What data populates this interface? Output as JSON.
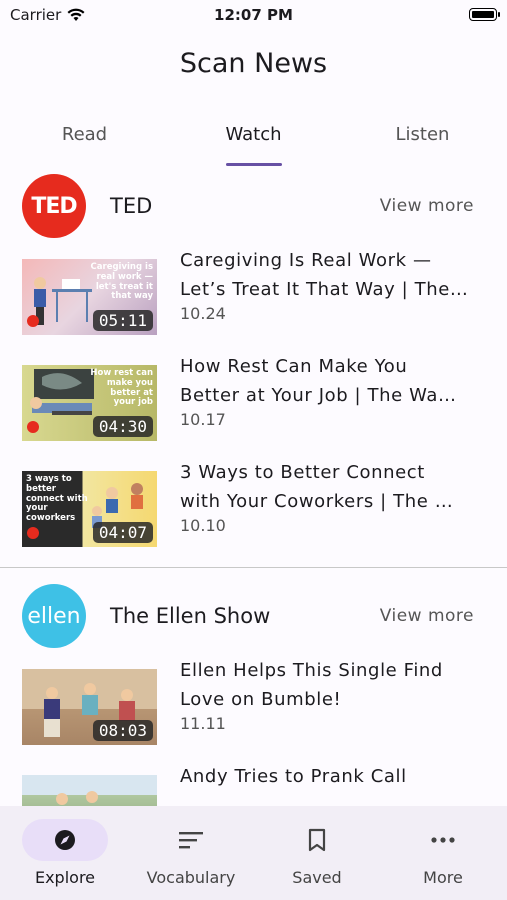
{
  "status_bar": {
    "carrier": "Carrier",
    "time": "12:07 PM"
  },
  "header": {
    "title": "Scan News"
  },
  "tabs": [
    {
      "label": "Read",
      "active": false
    },
    {
      "label": "Watch",
      "active": true
    },
    {
      "label": "Listen",
      "active": false
    }
  ],
  "channels": [
    {
      "name": "TED",
      "logo_text": "TED",
      "view_more": "View more",
      "videos": [
        {
          "title_line1": "Caregiving Is Real Work —",
          "title_line2": "Let’s Treat It That Way | The…",
          "date": "10.24",
          "duration": "05:11",
          "thumb_text": "Caregiving is real work — let's treat it that way"
        },
        {
          "title_line1": "How Rest Can Make You",
          "title_line2": "Better at Your Job | The Wa…",
          "date": "10.17",
          "duration": "04:30",
          "thumb_text": "How rest can make you better at your job"
        },
        {
          "title_line1": "3 Ways to Better Connect",
          "title_line2": "with Your Coworkers | The …",
          "date": "10.10",
          "duration": "04:07",
          "thumb_text": "3 ways to better connect with your coworkers"
        }
      ]
    },
    {
      "name": "The Ellen Show",
      "logo_text": "ellen",
      "view_more": "View more",
      "videos": [
        {
          "title_line1": "Ellen Helps This Single Find",
          "title_line2": "Love on Bumble!",
          "date": "11.11",
          "duration": "08:03"
        },
        {
          "title_line1": "Andy Tries to Prank Call",
          "title_line2": "",
          "date": "",
          "duration": ""
        }
      ]
    }
  ],
  "bottom_nav": [
    {
      "label": "Explore",
      "icon": "compass-icon",
      "active": true
    },
    {
      "label": "Vocabulary",
      "icon": "text-lines-icon",
      "active": false
    },
    {
      "label": "Saved",
      "icon": "bookmark-icon",
      "active": false
    },
    {
      "label": "More",
      "icon": "more-dots-icon",
      "active": false
    }
  ],
  "colors": {
    "accent": "#6750a4",
    "ted_red": "#e62b1e",
    "ellen_blue": "#3ec1e6",
    "nav_bg": "#f2eef6",
    "nav_active_pill": "#e8def8"
  }
}
